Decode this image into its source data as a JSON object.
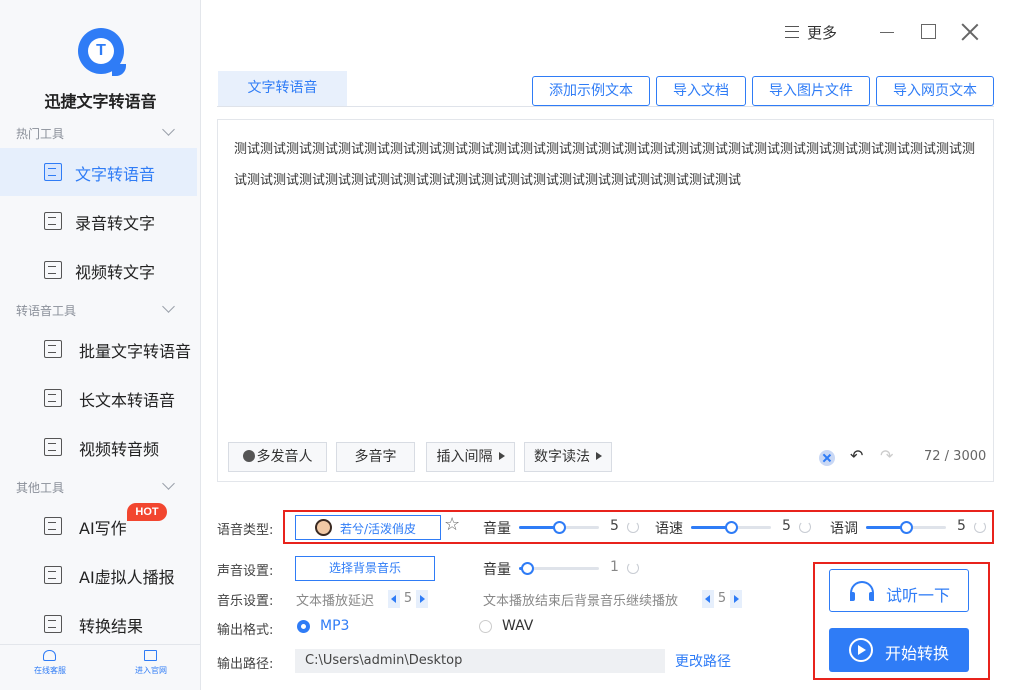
{
  "app": {
    "name": "迅捷文字转语音"
  },
  "sidebar": {
    "sections": [
      {
        "title": "热门工具"
      },
      {
        "title": "转语音工具"
      },
      {
        "title": "其他工具"
      }
    ],
    "items": [
      {
        "label": "文字转语音",
        "active": true
      },
      {
        "label": "录音转文字"
      },
      {
        "label": "视频转文字"
      },
      {
        "label": "批量文字转语音"
      },
      {
        "label": "长文本转语音"
      },
      {
        "label": "视频转音频"
      },
      {
        "label": "AI写作",
        "badge": "HOT"
      },
      {
        "label": "AI虚拟人播报"
      },
      {
        "label": "转换结果"
      }
    ],
    "footer": {
      "online_support": "在线客服",
      "official_site": "进入官网"
    }
  },
  "window": {
    "more_label": "更多"
  },
  "tabs": {
    "active": "文字转语音"
  },
  "toolbar": {
    "add_sample": "添加示例文本",
    "import_doc": "导入文档",
    "import_image": "导入图片文件",
    "import_web": "导入网页文本"
  },
  "editor": {
    "text": "测试测试测试测试测试测试测试测试测试测试测试测试测试测试测试测试测试测试测试测试测试测试测试测试测试测试测试测试测试测试测试测试测试测试测试测试测试测试测试测试测试测试测试测试测试测试测试测试",
    "tools": {
      "multi_speaker": "多发音人",
      "polyphone": "多音字",
      "insert_pause": "插入间隔",
      "number_reading": "数字读法"
    },
    "counter": "72 / 3000"
  },
  "voice": {
    "type_label": "语音类型:",
    "selected_voice": "若兮/活泼俏皮",
    "volume": {
      "label": "音量",
      "value": 5,
      "max": 10
    },
    "speed": {
      "label": "语速",
      "value": 5,
      "max": 10
    },
    "pitch": {
      "label": "语调",
      "value": 5,
      "max": 10
    }
  },
  "sound": {
    "label": "声音设置:",
    "bg_music_button": "选择背景音乐",
    "bg_volume": {
      "label": "音量",
      "value": 1,
      "max": 10
    }
  },
  "music": {
    "label": "音乐设置:",
    "delay_label": "文本播放延迟",
    "delay_value": "5",
    "continue_label": "文本播放结束后背景音乐继续播放",
    "continue_value": "5"
  },
  "output": {
    "format_label": "输出格式:",
    "formats": [
      {
        "label": "MP3",
        "checked": true
      },
      {
        "label": "WAV",
        "checked": false
      }
    ],
    "path_label": "输出路径:",
    "path_value": "C:\\Users\\admin\\Desktop",
    "change_path": "更改路径"
  },
  "actions": {
    "listen": "试听一下",
    "start": "开始转换"
  },
  "colors": {
    "accent": "#2f7cf6",
    "highlight_frame": "#e8231c",
    "hot_badge": "#f2462f"
  }
}
